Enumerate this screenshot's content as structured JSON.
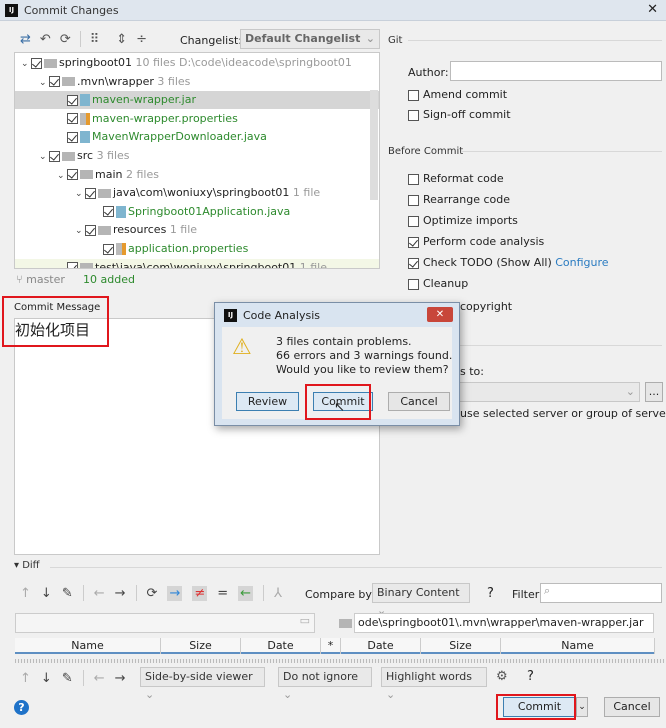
{
  "window": {
    "title": "Commit Changes"
  },
  "toolbar": {
    "changelist_label": "Changelist:",
    "changelist_value": "Default Changelist"
  },
  "tree": [
    {
      "label": "springboot01",
      "meta": "10 files  D:\\code\\ideacode\\springboot01",
      "level": 0,
      "type": "module"
    },
    {
      "label": ".mvn\\wrapper",
      "meta": "3 files",
      "level": 1,
      "type": "folder"
    },
    {
      "label": "maven-wrapper.jar",
      "meta": "",
      "level": 2,
      "type": "jar"
    },
    {
      "label": "maven-wrapper.properties",
      "meta": "",
      "level": 2,
      "type": "prop"
    },
    {
      "label": "MavenWrapperDownloader.java",
      "meta": "",
      "level": 2,
      "type": "java"
    },
    {
      "label": "src",
      "meta": "3 files",
      "level": 1,
      "type": "folder"
    },
    {
      "label": "main",
      "meta": "2 files",
      "level": 2,
      "type": "folder"
    },
    {
      "label": "java\\com\\woniuxy\\springboot01",
      "meta": "1 file",
      "level": 3,
      "type": "folder"
    },
    {
      "label": "Springboot01Application.java",
      "meta": "",
      "level": 4,
      "type": "java"
    },
    {
      "label": "resources",
      "meta": "1 file",
      "level": 3,
      "type": "folder"
    },
    {
      "label": "application.properties",
      "meta": "",
      "level": 4,
      "type": "prop"
    },
    {
      "label": "test\\java\\com\\woniuxy\\springboot01",
      "meta": "1 file",
      "level": 2,
      "type": "folder"
    }
  ],
  "status": {
    "branch": "master",
    "added": "10 added"
  },
  "commit_message": {
    "label": "Commit Message",
    "value": "初始化项目"
  },
  "git": {
    "section": "Git",
    "author_label": "Author:",
    "author_value": "",
    "amend": "Amend commit",
    "signoff": "Sign-off commit"
  },
  "before_commit": {
    "section": "Before Commit",
    "options": [
      {
        "label": "Reformat code",
        "checked": false
      },
      {
        "label": "Rearrange code",
        "checked": false
      },
      {
        "label": "Optimize imports",
        "checked": false
      },
      {
        "label": "Perform code analysis",
        "checked": true
      },
      {
        "label": "Check TODO (Show All)",
        "checked": true,
        "link": "Configure"
      },
      {
        "label": "Cleanup",
        "checked": false
      }
    ],
    "copyright_partial": "copyright",
    "upload_partial": "s to:",
    "server_hint_partial": "use selected server or group of servers",
    "browse": "..."
  },
  "dialog": {
    "title": "Code Analysis",
    "lines": [
      "3 files contain problems.",
      "66 errors and 3 warnings found.",
      "Would you like to review them?"
    ],
    "review": "Review",
    "commit": "Commit",
    "cancel": "Cancel"
  },
  "diff": {
    "section": "Diff",
    "compare_label": "Compare by:",
    "compare_value": "Binary Content",
    "help": "?",
    "filter_label": "Filter:",
    "filter_value": "",
    "right_path": "ode\\springboot01\\.mvn\\wrapper\\maven-wrapper.jar",
    "columns": [
      "Name",
      "Size",
      "Date",
      "*",
      "Date",
      "Size",
      "Name"
    ],
    "viewer": "Side-by-side viewer",
    "ignore": "Do not ignore",
    "highlight": "Highlight words"
  },
  "footer": {
    "commit": "Commit",
    "cancel": "Cancel"
  }
}
